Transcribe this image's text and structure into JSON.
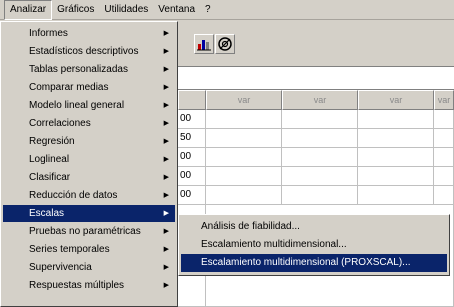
{
  "menubar": {
    "items": [
      {
        "label": "Analizar"
      },
      {
        "label": "Gráficos"
      },
      {
        "label": "Utilidades"
      },
      {
        "label": "Ventana"
      },
      {
        "label": "?"
      }
    ]
  },
  "toolbar": {
    "buttons": [
      {
        "icon": "chart-icon"
      },
      {
        "icon": "target-icon"
      }
    ]
  },
  "grid": {
    "columns": [
      "",
      "var",
      "var",
      "var",
      "var"
    ],
    "first_column_values": [
      "00",
      "50",
      "00",
      "00",
      "00"
    ]
  },
  "menu": {
    "items": [
      {
        "label": "Informes"
      },
      {
        "label": "Estadísticos descriptivos"
      },
      {
        "label": "Tablas personalizadas"
      },
      {
        "label": "Comparar medias"
      },
      {
        "label": "Modelo lineal general"
      },
      {
        "label": "Correlaciones"
      },
      {
        "label": "Regresión"
      },
      {
        "label": "Loglineal"
      },
      {
        "label": "Clasificar"
      },
      {
        "label": "Reducción de datos"
      },
      {
        "label": "Escalas"
      },
      {
        "label": "Pruebas no paramétricas"
      },
      {
        "label": "Series temporales"
      },
      {
        "label": "Supervivencia"
      },
      {
        "label": "Respuestas múltiples"
      }
    ],
    "selected": "Escalas"
  },
  "submenu": {
    "items": [
      {
        "label": "Análisis de fiabilidad..."
      },
      {
        "label": "Escalamiento multidimensional..."
      },
      {
        "label": "Escalamiento multidimensional (PROXSCAL)..."
      }
    ],
    "selected": "Escalamiento multidimensional (PROXSCAL)..."
  },
  "colors": {
    "highlight": "#0a246a",
    "face": "#d4d0c8"
  }
}
